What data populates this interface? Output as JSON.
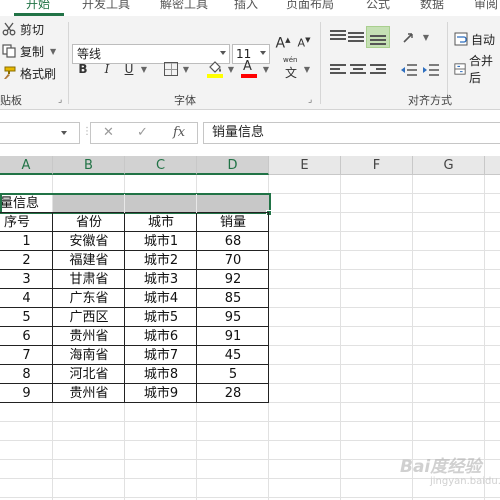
{
  "ribbon_tabs": [
    "开始",
    "开发工具",
    "解密工具",
    "插入",
    "页面布局",
    "公式",
    "数据",
    "审阅"
  ],
  "clipboard": {
    "cut_label": "剪切",
    "copy_label": "复制",
    "format_painter_label": "格式刷",
    "group_label": "贴板"
  },
  "font": {
    "name": "等线",
    "size": "11",
    "grow_label": "A",
    "shrink_label": "A",
    "bold_label": "B",
    "italic_label": "I",
    "underline_label": "U",
    "phonetic_label": "wén",
    "phonetic_char": "文",
    "group_label": "字体",
    "fill_color": "#ffff00",
    "font_color": "#ff0000"
  },
  "alignment": {
    "wrap_text_label": "自动",
    "merge_label": "合并后",
    "group_label": "对齐方式"
  },
  "formula_bar": {
    "cancel": "✕",
    "enter": "✓",
    "fx": "fx",
    "content": "销量信息"
  },
  "columns": [
    "A",
    "B",
    "C",
    "D",
    "E",
    "F",
    "G"
  ],
  "selected_columns": [
    "A",
    "B",
    "C",
    "D"
  ],
  "sheet": {
    "title_cell": "量信息",
    "headers": [
      "序号",
      "省份",
      "城市",
      "销量"
    ],
    "rows": [
      [
        "1",
        "安徽省",
        "城市1",
        "68"
      ],
      [
        "2",
        "福建省",
        "城市2",
        "70"
      ],
      [
        "3",
        "甘肃省",
        "城市3",
        "92"
      ],
      [
        "4",
        "广东省",
        "城市4",
        "85"
      ],
      [
        "5",
        "广西区",
        "城市5",
        "95"
      ],
      [
        "6",
        "贵州省",
        "城市6",
        "91"
      ],
      [
        "7",
        "海南省",
        "城市7",
        "45"
      ],
      [
        "8",
        "河北省",
        "城市8",
        "5"
      ],
      [
        "9",
        "贵州省",
        "城市9",
        "28"
      ]
    ]
  },
  "accent_color": "#217346",
  "watermark": {
    "text": "Bai度经验",
    "sub": "jingyan.baidu.com"
  }
}
